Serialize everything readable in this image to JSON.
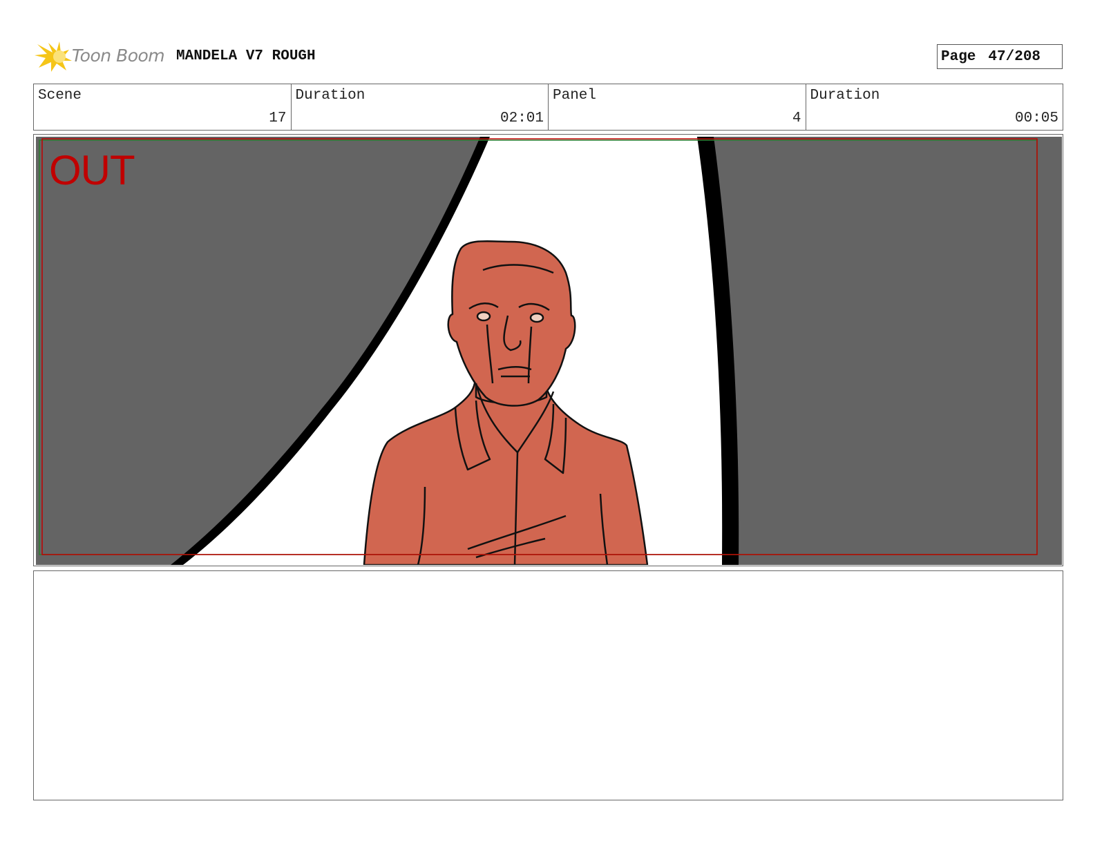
{
  "header": {
    "brand": "Toon Boom",
    "project_title": "MANDELA V7 ROUGH",
    "page_label": "Page",
    "page_number": "47/208"
  },
  "info": [
    {
      "label": "Scene",
      "value": "17"
    },
    {
      "label": "Duration",
      "value": "02:01"
    },
    {
      "label": "Panel",
      "value": "4"
    },
    {
      "label": "Duration",
      "value": "00:05"
    }
  ],
  "panel": {
    "overlay_text": "OUT",
    "colors": {
      "curtain": "#646464",
      "figure": "#d16650",
      "safe_frame": "#c00000",
      "overlay_text": "#c00000"
    }
  },
  "notes": {
    "text": ""
  }
}
